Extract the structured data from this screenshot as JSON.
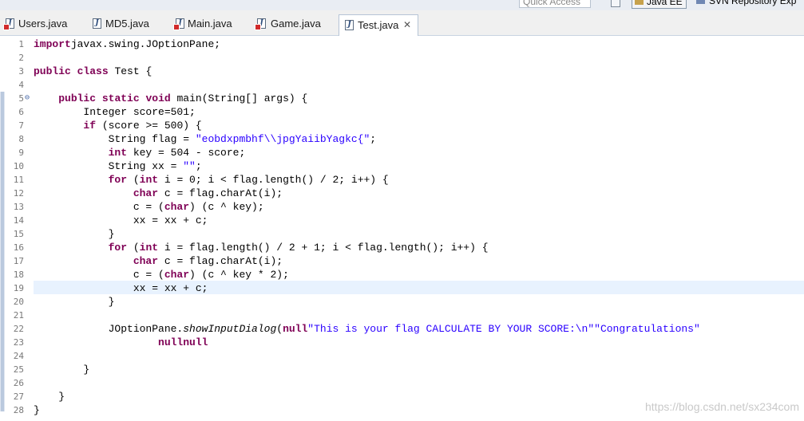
{
  "toolbar": {
    "quick_access": "Quick Access",
    "perspective_java_ee": "Java EE",
    "perspective_svn": "SVN Repository Exp"
  },
  "tabs": [
    {
      "label": "Users.java",
      "icon": "java-file-error-icon",
      "active": false
    },
    {
      "label": "MD5.java",
      "icon": "java-file-icon",
      "active": false
    },
    {
      "label": "Main.java",
      "icon": "java-file-error-icon",
      "active": false
    },
    {
      "label": "Game.java",
      "icon": "java-file-error-icon",
      "active": false
    },
    {
      "label": "Test.java",
      "icon": "java-file-icon",
      "active": true,
      "close": "✕"
    }
  ],
  "editor": {
    "current_line": 19,
    "line_numbers": [
      "1",
      "2",
      "3",
      "4",
      "5",
      "6",
      "7",
      "8",
      "9",
      "10",
      "11",
      "12",
      "13",
      "14",
      "15",
      "16",
      "17",
      "18",
      "19",
      "20",
      "21",
      "22",
      "23",
      "24",
      "25",
      "26",
      "27",
      "28"
    ],
    "watermark": "https://blog.csdn.net/sx234com"
  },
  "colors": {
    "keyword": "#7f0055",
    "string": "#2a00ff",
    "current_line": "#e8f2fe",
    "line_number": "#787878"
  }
}
